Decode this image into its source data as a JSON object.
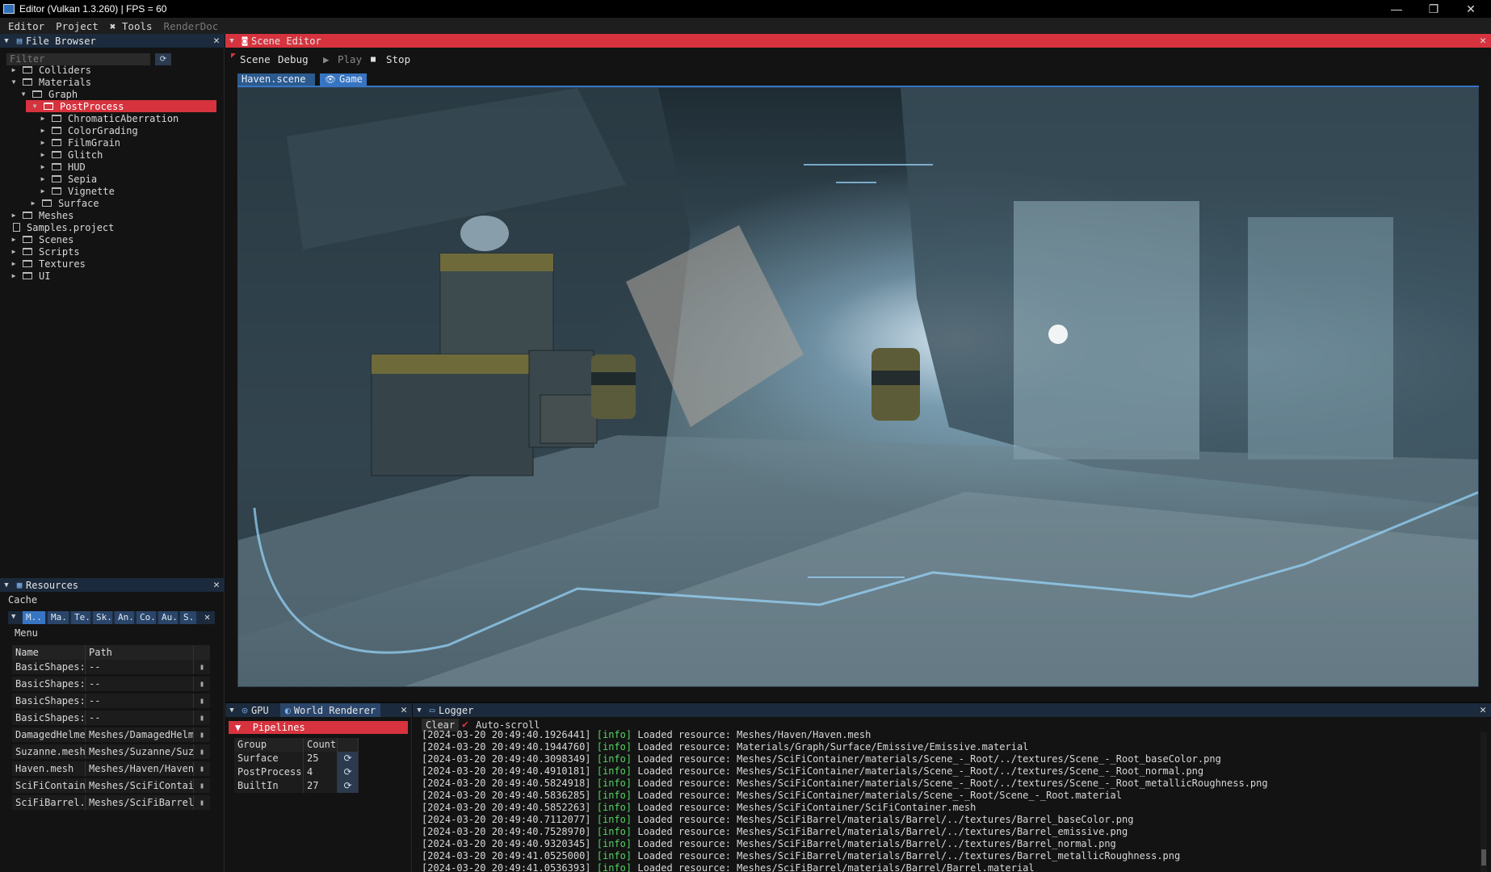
{
  "window": {
    "title": "Editor (Vulkan 1.3.260) | FPS = 60",
    "controls": {
      "minimize": "—",
      "restore": "❐",
      "close": "✕"
    }
  },
  "menubar": [
    "Editor",
    "Project",
    "Tools",
    "RenderDoc"
  ],
  "file_browser": {
    "title": "File Browser",
    "filter_placeholder": "Filter",
    "tree": [
      {
        "label": "Colliders",
        "depth": 0,
        "type": "folder",
        "expanded": false
      },
      {
        "label": "Materials",
        "depth": 0,
        "type": "folder",
        "expanded": true
      },
      {
        "label": "Graph",
        "depth": 1,
        "type": "folder",
        "expanded": true
      },
      {
        "label": "PostProcess",
        "depth": 2,
        "type": "folder",
        "expanded": true,
        "selected": true
      },
      {
        "label": "ChromaticAberration",
        "depth": 3,
        "type": "folder",
        "expanded": false
      },
      {
        "label": "ColorGrading",
        "depth": 3,
        "type": "folder",
        "expanded": false
      },
      {
        "label": "FilmGrain",
        "depth": 3,
        "type": "folder",
        "expanded": false
      },
      {
        "label": "Glitch",
        "depth": 3,
        "type": "folder",
        "expanded": false
      },
      {
        "label": "HUD",
        "depth": 3,
        "type": "folder",
        "expanded": false
      },
      {
        "label": "Sepia",
        "depth": 3,
        "type": "folder",
        "expanded": false
      },
      {
        "label": "Vignette",
        "depth": 3,
        "type": "folder",
        "expanded": false
      },
      {
        "label": "Surface",
        "depth": 2,
        "type": "folder",
        "expanded": false
      },
      {
        "label": "Meshes",
        "depth": 0,
        "type": "folder",
        "expanded": false
      },
      {
        "label": "Samples.project",
        "depth": 0,
        "type": "file"
      },
      {
        "label": "Scenes",
        "depth": 0,
        "type": "folder",
        "expanded": false
      },
      {
        "label": "Scripts",
        "depth": 0,
        "type": "folder",
        "expanded": false
      },
      {
        "label": "Textures",
        "depth": 0,
        "type": "folder",
        "expanded": false
      },
      {
        "label": "UI",
        "depth": 0,
        "type": "folder",
        "expanded": false
      }
    ]
  },
  "resources": {
    "title": "Resources",
    "cache_label": "Cache",
    "menu_label": "Menu",
    "tabs": [
      "M..",
      "Ma..",
      "Te..",
      "Sk..",
      "An..",
      "Co..",
      "Au..",
      "S.."
    ],
    "columns": [
      "Name",
      "Path"
    ],
    "rows": [
      {
        "name": "BasicShapes:",
        "path": "--"
      },
      {
        "name": "BasicShapes:",
        "path": "--"
      },
      {
        "name": "BasicShapes:",
        "path": "--"
      },
      {
        "name": "BasicShapes:",
        "path": "--"
      },
      {
        "name": "DamagedHelme",
        "path": "Meshes/DamagedHelme"
      },
      {
        "name": "Suzanne.mesh",
        "path": "Meshes/Suzanne/Suza"
      },
      {
        "name": "Haven.mesh",
        "path": "Meshes/Haven/Haven."
      },
      {
        "name": "SciFiContain",
        "path": "Meshes/SciFiContair"
      },
      {
        "name": "SciFiBarrel.",
        "path": "Meshes/SciFiBarrel/"
      }
    ]
  },
  "scene_editor": {
    "title": "Scene Editor",
    "toolbar": {
      "scene": "Scene",
      "debug": "Debug",
      "play": "Play",
      "stop": "Stop"
    },
    "tabs": [
      {
        "label": "Haven.scene",
        "active": false
      },
      {
        "label": "Game",
        "active": true
      }
    ]
  },
  "bottom_left": {
    "tabs": [
      "GPU",
      "World Renderer"
    ],
    "section": "Pipelines",
    "columns": [
      "Group",
      "Count"
    ],
    "rows": [
      {
        "group": "Surface",
        "count": "25"
      },
      {
        "group": "PostProcess",
        "count": "4"
      },
      {
        "group": "BuiltIn",
        "count": "27"
      }
    ]
  },
  "logger": {
    "title": "Logger",
    "clear_label": "Clear",
    "autoscroll_label": "Auto-scroll",
    "autoscroll": true,
    "lines": [
      {
        "ts": "[2024-03-20 20:49:40.1926441]",
        "level": "[info]",
        "msg": "Loaded resource: Meshes/Haven/Haven.mesh"
      },
      {
        "ts": "[2024-03-20 20:49:40.1944760]",
        "level": "[info]",
        "msg": "Loaded resource: Materials/Graph/Surface/Emissive/Emissive.material"
      },
      {
        "ts": "[2024-03-20 20:49:40.3098349]",
        "level": "[info]",
        "msg": "Loaded resource: Meshes/SciFiContainer/materials/Scene_-_Root/../textures/Scene_-_Root_baseColor.png"
      },
      {
        "ts": "[2024-03-20 20:49:40.4910181]",
        "level": "[info]",
        "msg": "Loaded resource: Meshes/SciFiContainer/materials/Scene_-_Root/../textures/Scene_-_Root_normal.png"
      },
      {
        "ts": "[2024-03-20 20:49:40.5824918]",
        "level": "[info]",
        "msg": "Loaded resource: Meshes/SciFiContainer/materials/Scene_-_Root/../textures/Scene_-_Root_metallicRoughness.png"
      },
      {
        "ts": "[2024-03-20 20:49:40.5836285]",
        "level": "[info]",
        "msg": "Loaded resource: Meshes/SciFiContainer/materials/Scene_-_Root/Scene_-_Root.material"
      },
      {
        "ts": "[2024-03-20 20:49:40.5852263]",
        "level": "[info]",
        "msg": "Loaded resource: Meshes/SciFiContainer/SciFiContainer.mesh"
      },
      {
        "ts": "[2024-03-20 20:49:40.7112077]",
        "level": "[info]",
        "msg": "Loaded resource: Meshes/SciFiBarrel/materials/Barrel/../textures/Barrel_baseColor.png"
      },
      {
        "ts": "[2024-03-20 20:49:40.7528970]",
        "level": "[info]",
        "msg": "Loaded resource: Meshes/SciFiBarrel/materials/Barrel/../textures/Barrel_emissive.png"
      },
      {
        "ts": "[2024-03-20 20:49:40.9320345]",
        "level": "[info]",
        "msg": "Loaded resource: Meshes/SciFiBarrel/materials/Barrel/../textures/Barrel_normal.png"
      },
      {
        "ts": "[2024-03-20 20:49:41.0525000]",
        "level": "[info]",
        "msg": "Loaded resource: Meshes/SciFiBarrel/materials/Barrel/../textures/Barrel_metallicRoughness.png"
      },
      {
        "ts": "[2024-03-20 20:49:41.0536393]",
        "level": "[info]",
        "msg": "Loaded resource: Meshes/SciFiBarrel/materials/Barrel/Barrel.material"
      }
    ]
  },
  "colors": {
    "accent_red": "#d6333e",
    "panel_header": "#1b2a3c",
    "tab_blue": "#3775c2",
    "log_info": "#56d364"
  }
}
